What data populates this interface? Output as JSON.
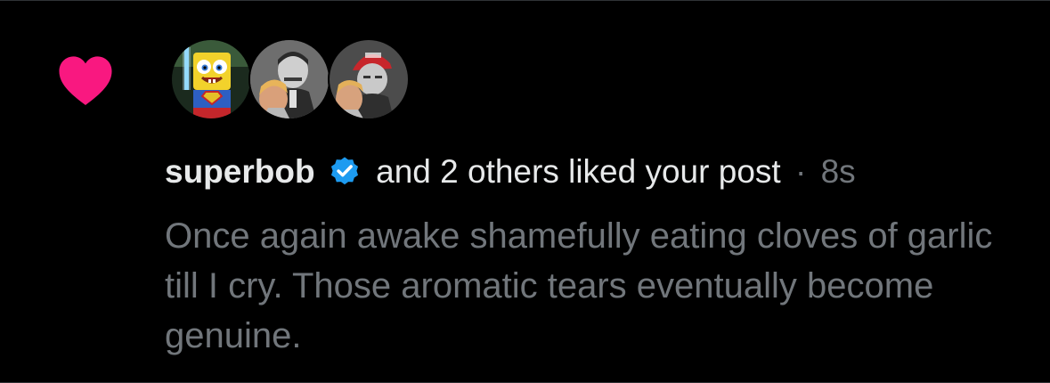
{
  "notification": {
    "type_icon": "heart-icon",
    "heart_color": "#f91880",
    "avatars": [
      {
        "icon": "avatar-spongebob"
      },
      {
        "icon": "avatar-man-with-child"
      },
      {
        "icon": "avatar-man-red-cap"
      }
    ],
    "username": "superbob",
    "verified_icon": "verified-badge-icon",
    "verified_color": "#1d9bf0",
    "action_text": "and 2 others liked your post",
    "separator": "·",
    "time_ago": "8s",
    "post_text": "Once again awake shamefully eating cloves of garlic till I cry. Those aromatic tears eventually become genuine."
  }
}
